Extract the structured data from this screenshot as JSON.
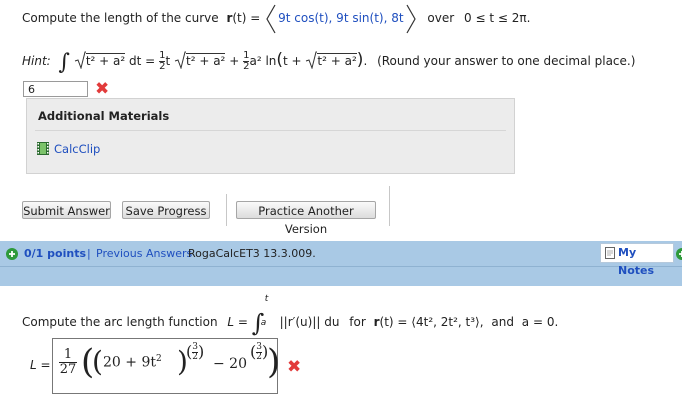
{
  "question1": {
    "prefix": "Compute the length of the curve",
    "vec_r": "r",
    "r_arg": "(t) =",
    "components": "9t cos(t), 9t sin(t), 8t",
    "interval_word": "over",
    "interval": "0 ≤ t ≤ 2π."
  },
  "hint": {
    "label": "Hint:",
    "integrand": "t² + a² dt =",
    "term2": "t",
    "term3": "a² ln",
    "note": "(Round your answer to one decimal place.)"
  },
  "answer1": {
    "value": "6",
    "status_icon": "x-icon",
    "status_color": "#e23b3b"
  },
  "materials": {
    "title": "Additional Materials",
    "items": [
      {
        "label": "CalcClip",
        "icon": "film-icon"
      }
    ]
  },
  "buttons": {
    "submit": "Submit Answer",
    "save": "Save Progress",
    "practice": "Practice Another Version"
  },
  "question_header": {
    "points": "0/1 points",
    "separator": "|",
    "previous": "Previous Answers",
    "source": "RogaCalcET3 13.3.009.",
    "my_notes": "My Notes"
  },
  "question2": {
    "prefix": "Compute the arc length function",
    "L_eq": "L =",
    "integrand": "||r′(u)|| du",
    "for_word": "for",
    "r_def_lhs": "(t) =",
    "r_def": "⟨4t², 2t², t³⟩,",
    "and_word": "and",
    "a_eq": "a = 0.",
    "lower_limit": "a",
    "upper_limit": "t"
  },
  "answer2": {
    "L_label": "L =",
    "coef_num": "1",
    "coef_den": "27",
    "base1": "20 + 9t",
    "sq": "2",
    "exp_num": "3",
    "exp_den": "2",
    "minus": "− 20",
    "status_icon": "x-icon"
  },
  "colors": {
    "accent": "#1f4fbf",
    "header_bg": "#a9c9e5",
    "error": "#e23b3b",
    "points_icon": "#2e9a3a"
  }
}
